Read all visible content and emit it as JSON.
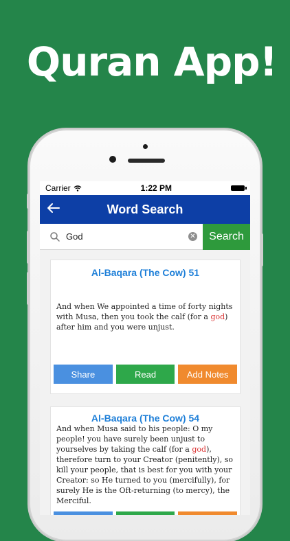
{
  "promo": {
    "headline": "Quran App!"
  },
  "status_bar": {
    "carrier": "Carrier",
    "time": "1:22 PM"
  },
  "nav": {
    "title": "Word Search",
    "back_icon": "back-arrow-icon"
  },
  "search": {
    "query": "God",
    "button_label": "Search"
  },
  "results": [
    {
      "title": "Al-Baqara (The Cow) 51",
      "text_before": "And when We appointed a time of forty nights with Musa, then you took the calf (for a ",
      "highlight": "god",
      "text_after": ") after him and you were unjust."
    },
    {
      "title": "Al-Baqara (The Cow) 54",
      "text_before": "And when Musa said to his people: O my people! you have surely been unjust to yourselves by taking the calf (for a ",
      "highlight": "god",
      "text_after": "), therefore turn to your Creator (penitently), so kill your people, that is best for you with your Creator: so He turned to you (mercifully), for surely He is the Oft-returning (to mercy), the Merciful."
    }
  ],
  "actions": {
    "share": "Share",
    "read": "Read",
    "add_notes": "Add Notes"
  },
  "colors": {
    "background": "#24854a",
    "navbar": "#0d3fa6",
    "search_button": "#2e9a3c",
    "title_blue": "#1e7fd8",
    "highlight_red": "#d93030",
    "share": "#4a90e0",
    "read": "#2ea84a",
    "add_notes": "#f08a2e"
  }
}
